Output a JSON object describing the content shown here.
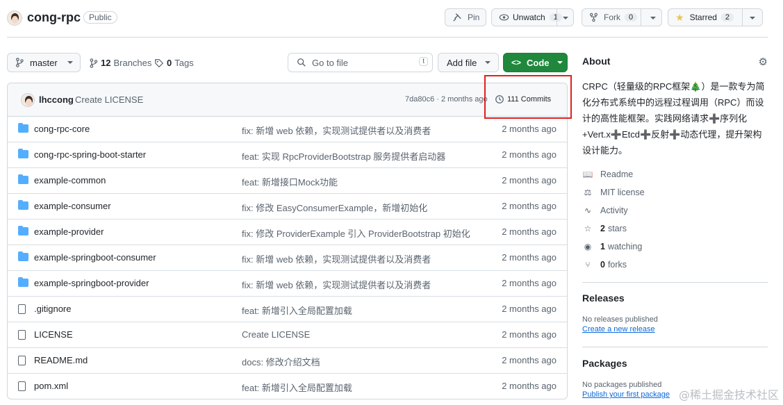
{
  "repo": {
    "name": "cong-rpc",
    "visibility": "Public"
  },
  "actions": {
    "pin": "Pin",
    "unwatch": "Unwatch",
    "watch_count": "1",
    "fork": "Fork",
    "fork_count": "0",
    "starred": "Starred",
    "star_count": "2"
  },
  "toolbar": {
    "branch": "master",
    "branches_count": "12",
    "branches_label": "Branches",
    "tags_count": "0",
    "tags_label": "Tags",
    "search_placeholder": "Go to file",
    "search_key": "t",
    "add_file": "Add file",
    "code": "Code"
  },
  "commit": {
    "author": "lhccong",
    "message": "Create LICENSE",
    "hash_time": "7da80c6 · 2 months ago",
    "commits_label": "111 Commits"
  },
  "files": [
    {
      "type": "dir",
      "name": "cong-rpc-core",
      "message": "fix: 新增 web 依赖，实现测试提供者以及消费者",
      "date": "2 months ago"
    },
    {
      "type": "dir",
      "name": "cong-rpc-spring-boot-starter",
      "message": "feat: 实现 RpcProviderBootstrap 服务提供者启动器",
      "date": "2 months ago"
    },
    {
      "type": "dir",
      "name": "example-common",
      "message": "feat: 新增接口Mock功能",
      "date": "2 months ago"
    },
    {
      "type": "dir",
      "name": "example-consumer",
      "message": "fix: 修改 EasyConsumerExample，新增初始化",
      "date": "2 months ago"
    },
    {
      "type": "dir",
      "name": "example-provider",
      "message": "fix: 修改 ProviderExample 引入 ProviderBootstrap 初始化",
      "date": "2 months ago"
    },
    {
      "type": "dir",
      "name": "example-springboot-consumer",
      "message": "fix: 新增 web 依赖，实现测试提供者以及消费者",
      "date": "2 months ago"
    },
    {
      "type": "dir",
      "name": "example-springboot-provider",
      "message": "fix: 新增 web 依赖，实现测试提供者以及消费者",
      "date": "2 months ago"
    },
    {
      "type": "file",
      "name": ".gitignore",
      "message": "feat: 新增引入全局配置加载",
      "date": "2 months ago"
    },
    {
      "type": "file",
      "name": "LICENSE",
      "message": "Create LICENSE",
      "date": "2 months ago"
    },
    {
      "type": "file",
      "name": "README.md",
      "message": "docs: 修改介绍文档",
      "date": "2 months ago"
    },
    {
      "type": "file",
      "name": "pom.xml",
      "message": "feat: 新增引入全局配置加载",
      "date": "2 months ago"
    }
  ],
  "about": {
    "heading": "About",
    "description": "CRPC（轻量级的RPC框架🎄）是一款专为简化分布式系统中的远程过程调用（RPC）而设计的高性能框架。实践网络请求➕序列化+Vert.x➕Etcd➕反射➕动态代理，提升架构设计能力。",
    "readme": "Readme",
    "license": "MIT license",
    "activity": "Activity",
    "stars_count": "2",
    "stars_label": "stars",
    "watching_count": "1",
    "watching_label": "watching",
    "forks_count": "0",
    "forks_label": "forks"
  },
  "releases": {
    "heading": "Releases",
    "none": "No releases published",
    "create": "Create a new release"
  },
  "packages": {
    "heading": "Packages",
    "none": "No packages published",
    "publish": "Publish your first package"
  },
  "watermark": "@稀土掘金技术社区",
  "colors": {
    "accent_green": "#1f883d",
    "link_blue": "#0969da",
    "folder_blue": "#54aeff",
    "highlight_red": "#e0201b"
  }
}
